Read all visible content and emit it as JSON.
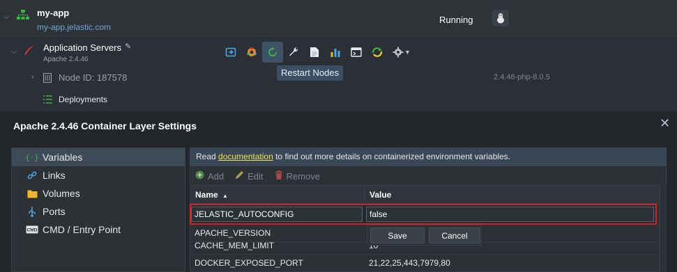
{
  "environment": {
    "name": "my-app",
    "domain": "my-app.jelastic.com",
    "status": "Running"
  },
  "node_group": {
    "name": "Application Servers",
    "version": "Apache 2.4.46",
    "node_id": "Node ID: 187578",
    "tag": "2.4.46-php-8.0.5",
    "deployments": "Deployments"
  },
  "toolbar": {
    "tooltip": "Restart Nodes",
    "icons": [
      "redeploy-icon",
      "add-ons-icon",
      "restart-nodes-icon",
      "config-icon",
      "log-icon",
      "statistics-icon",
      "web-ssh-icon",
      "import-icon",
      "settings-icon"
    ]
  },
  "dialog": {
    "title": "Apache 2.4.46 Container Layer Settings",
    "nav": [
      {
        "label": "Variables",
        "icon": "variables-icon"
      },
      {
        "label": "Links",
        "icon": "links-icon"
      },
      {
        "label": "Volumes",
        "icon": "volumes-icon"
      },
      {
        "label": "Ports",
        "icon": "ports-icon"
      },
      {
        "label": "CMD / Entry Point",
        "icon": "cmd-icon"
      }
    ],
    "info": {
      "prefix": "Read ",
      "link": "documentation",
      "suffix": " to find out more details on containerized environment variables."
    },
    "actions": {
      "add": "Add",
      "edit": "Edit",
      "remove": "Remove"
    },
    "columns": {
      "name": "Name",
      "value": "Value"
    },
    "editing": {
      "name": "JELASTIC_AUTOCONFIG",
      "value": "false"
    },
    "rows": [
      {
        "name": "APACHE_VERSION",
        "value": ""
      },
      {
        "name": "CACHE_MEM_LIMIT",
        "value": "10"
      },
      {
        "name": "DOCKER_EXPOSED_PORT",
        "value": "21,22,25,443,7979,80"
      }
    ],
    "buttons": {
      "save": "Save",
      "cancel": "Cancel"
    }
  },
  "colors": {
    "accent": "#3e5366",
    "highlight": "#d0242b",
    "link": "#f2e34a"
  }
}
